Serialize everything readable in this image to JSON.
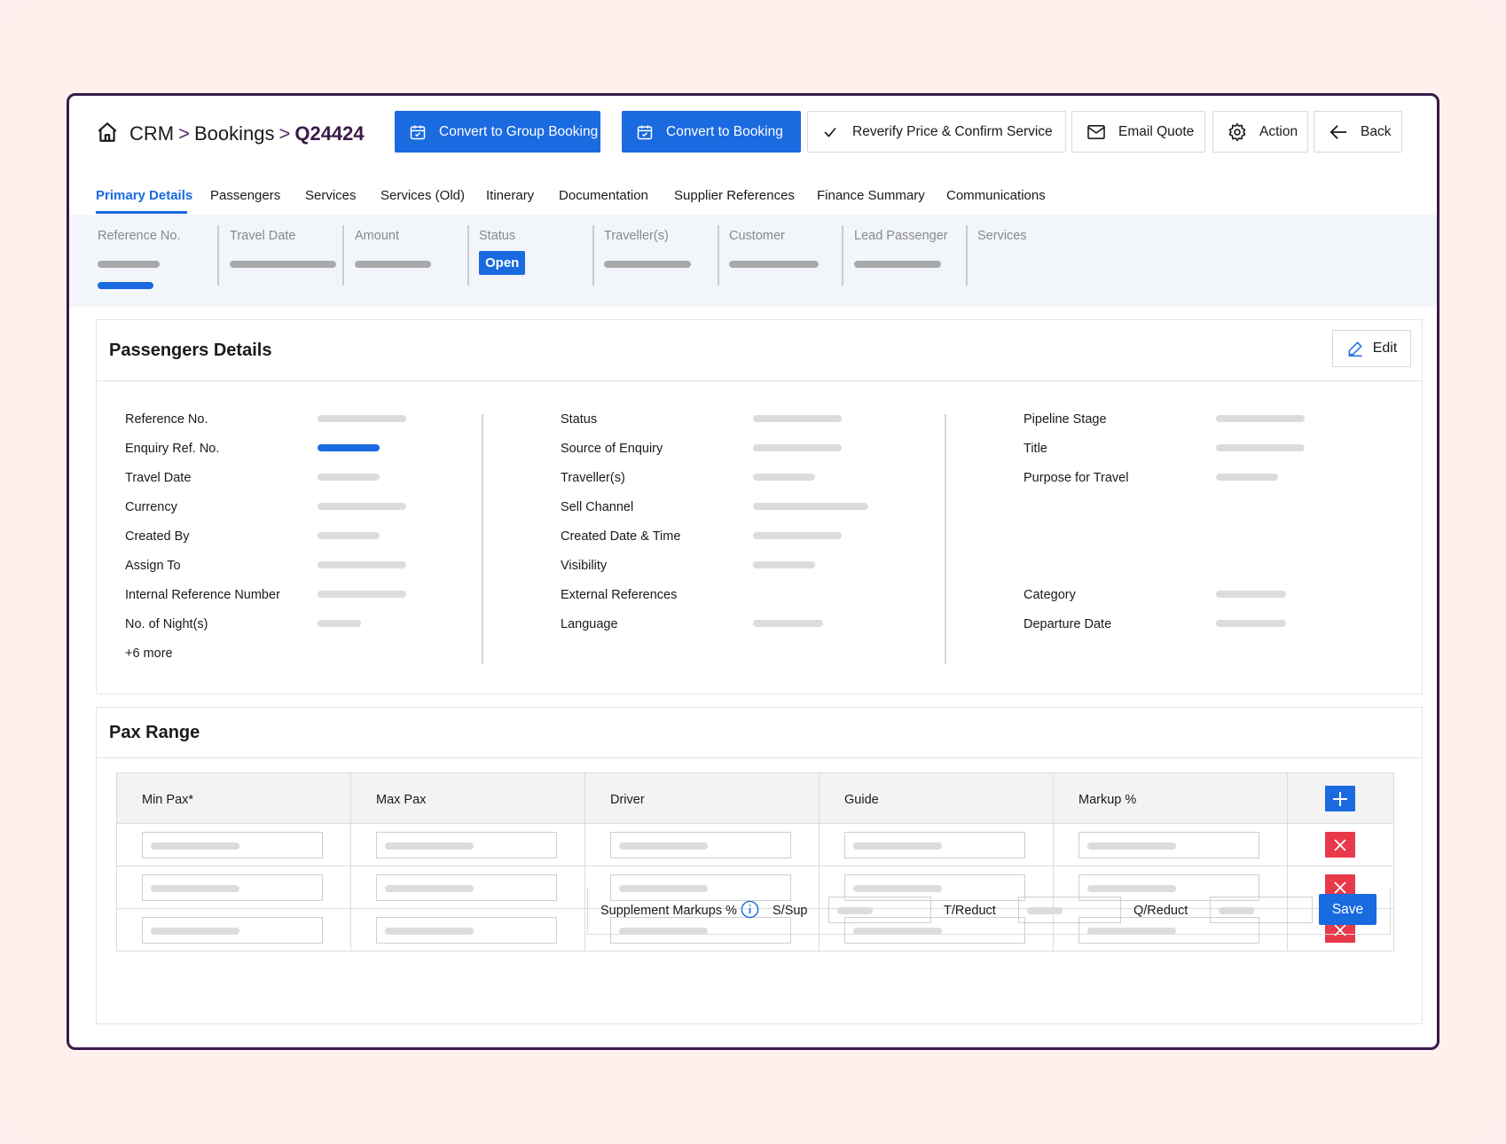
{
  "breadcrumb": {
    "root": "CRM",
    "sep1": ">",
    "section": "Bookings",
    "sep2": ">",
    "current": "Q24424"
  },
  "toolbar": {
    "convert_group": "Convert to Group Booking",
    "convert_booking": "Convert to Booking",
    "reverify": "Reverify Price & Confirm Service",
    "email_quote": "Email Quote",
    "action": "Action",
    "back": "Back"
  },
  "tabs": [
    "Primary Details",
    "Passengers",
    "Services",
    "Services (Old)",
    "Itinerary",
    "Documentation",
    "Supplier References",
    "Finance Summary",
    "Communications"
  ],
  "summary": {
    "reference_no": "Reference No.",
    "travel_date": "Travel Date",
    "amount": "Amount",
    "status": "Status",
    "status_value": "Open",
    "travellers": "Traveller(s)",
    "customer": "Customer",
    "lead_passenger": "Lead Passenger",
    "services": "Services"
  },
  "passengers_details": {
    "title": "Passengers Details",
    "edit_label": "Edit",
    "col1": [
      "Reference No.",
      "Enquiry Ref. No.",
      "Travel Date",
      "Currency",
      "Created By",
      "Assign To",
      "Internal Reference Number",
      "No. of Night(s)",
      "+6 more"
    ],
    "col2": [
      "Status",
      "Source of Enquiry",
      "Traveller(s)",
      "Sell Channel",
      "Created Date & Time",
      "Visibility",
      "External References",
      "Language"
    ],
    "col3": [
      "Pipeline Stage",
      "Title",
      "Purpose for Travel",
      "Category",
      "Departure Date"
    ]
  },
  "pax_range": {
    "title": "Pax Range",
    "headers": [
      "Min Pax*",
      "Max Pax",
      "Driver",
      "Guide",
      "Markup %"
    ],
    "supplement_label": "Supplement Markups %",
    "s_sup": "S/Sup",
    "t_reduct": "T/Reduct",
    "q_reduct": "Q/Reduct",
    "save_label": "Save"
  },
  "colors": {
    "primary": "#1a6ae0",
    "danger": "#e8394a",
    "brand_dark": "#3b1a4a"
  }
}
